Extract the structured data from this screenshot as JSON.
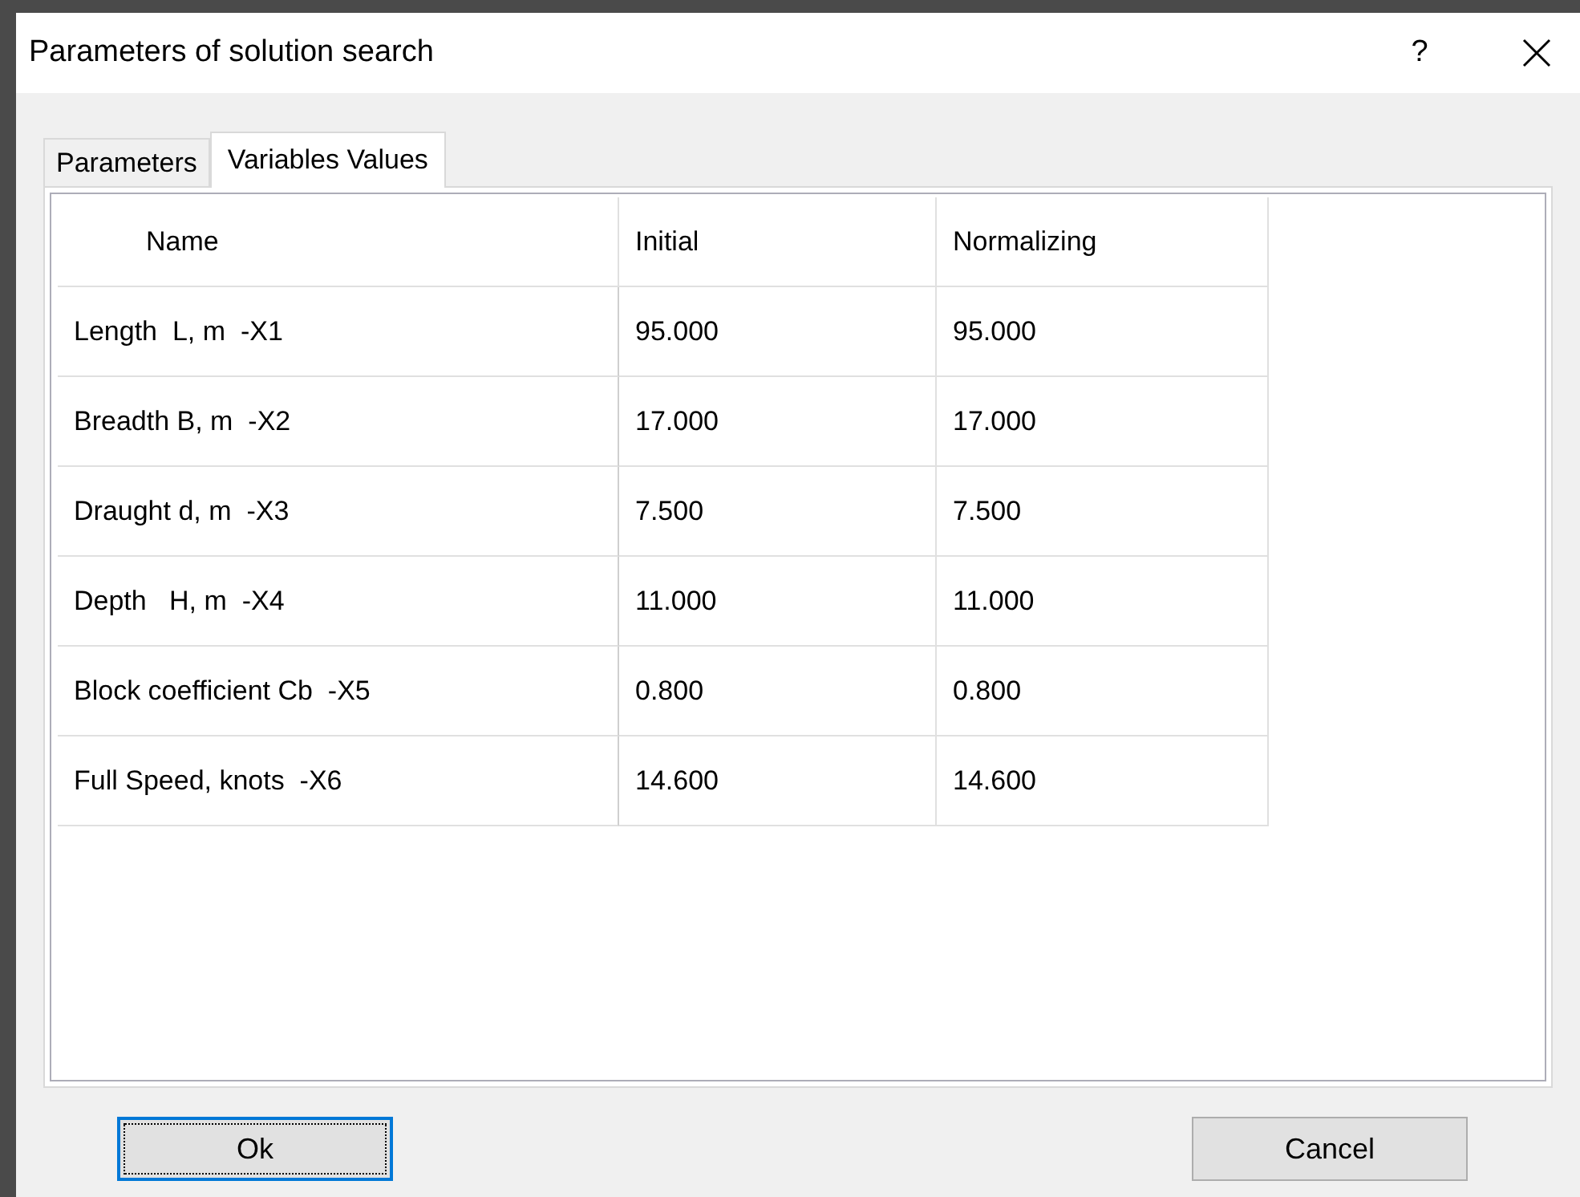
{
  "window": {
    "title": "Parameters of solution search",
    "help": "?"
  },
  "tabs": [
    {
      "label": "Parameters",
      "selected": false
    },
    {
      "label": "Variables Values",
      "selected": true
    }
  ],
  "table": {
    "columns": [
      "Name",
      "Initial",
      "Normalizing"
    ],
    "rows": [
      [
        "Length  L, m  -X1",
        "95.000",
        "95.000"
      ],
      [
        "Breadth B, m  -X2",
        "17.000",
        "17.000"
      ],
      [
        "Draught d, m  -X3",
        "7.500",
        "7.500"
      ],
      [
        "Depth   H, m  -X4",
        "11.000",
        "11.000"
      ],
      [
        "Block coefficient Cb  -X5",
        "0.800",
        "0.800"
      ],
      [
        "Full Speed, knots  -X6",
        "14.600",
        "14.600"
      ]
    ]
  },
  "buttons": [
    {
      "label": "Ok",
      "focused": true
    },
    {
      "label": "Cancel",
      "focused": false
    }
  ]
}
